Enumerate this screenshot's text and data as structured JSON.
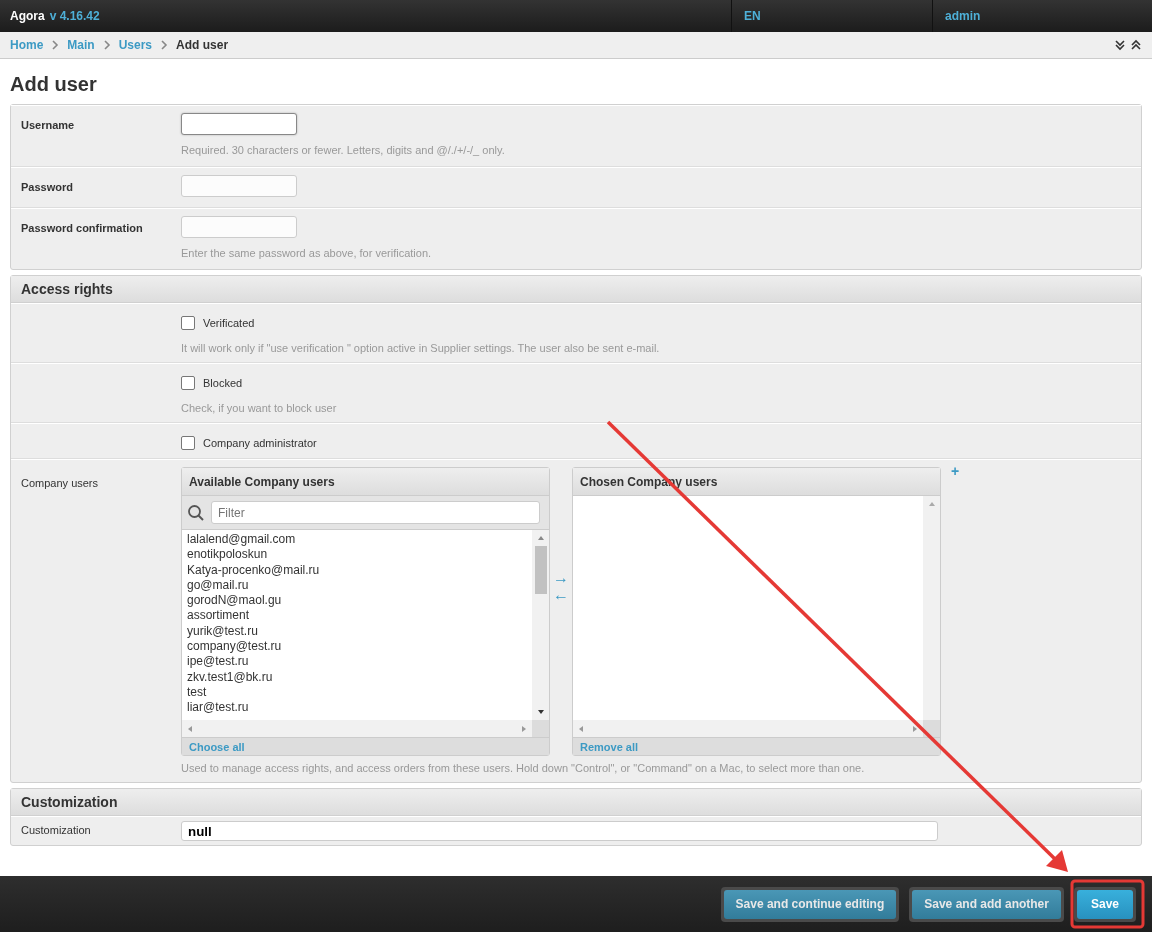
{
  "topbar": {
    "brand": "Agora",
    "version": "v 4.16.42",
    "language": "EN",
    "user": "admin"
  },
  "breadcrumbs": {
    "links": [
      "Home",
      "Main",
      "Users"
    ],
    "current": "Add user"
  },
  "title": "Add user",
  "account_fields": [
    {
      "label": "Username",
      "focused": true,
      "help": "Required. 30 characters or fewer. Letters, digits and @/./+/-/_ only."
    },
    {
      "label": "Password",
      "focused": false
    },
    {
      "label": "Password confirmation",
      "focused": false,
      "help": "Enter the same password as above, for verification."
    }
  ],
  "access_rights": {
    "title": "Access rights",
    "options": [
      {
        "label": "Verificated",
        "checked": false,
        "help": "It will work only if \"use verification \" option active in Supplier settings. The user also be sent e-mail."
      },
      {
        "label": "Blocked",
        "checked": false,
        "help": "Check, if you want to block user"
      },
      {
        "label": "Company administrator",
        "checked": false
      }
    ],
    "company_users": {
      "label": "Company users",
      "available": {
        "title": "Available Company users",
        "filter_placeholder": "Filter",
        "action": "Choose all",
        "items": [
          "lalalend@gmail.com",
          "enotikpoloskun",
          "Katya-procenko@mail.ru",
          "go@mail.ru",
          "gorodN@maol.gu",
          "assortiment",
          "yurik@test.ru",
          "company@test.ru",
          "ipe@test.ru",
          "zkv.test1@bk.ru",
          "test",
          "liar@test.ru"
        ]
      },
      "move_right": "→",
      "move_left": "←",
      "chosen": {
        "title": "Chosen Company users",
        "action": "Remove all"
      },
      "add_symbol": "+",
      "help": "Used to manage access rights, and access orders from these users. Hold down \"Control\", or \"Command\" on a Mac, to select more than one."
    }
  },
  "customization": {
    "title": "Customization",
    "label": "Customization",
    "value": "null"
  },
  "actions": [
    {
      "label": "Save and continue editing",
      "primary": false
    },
    {
      "label": "Save and add another",
      "primary": false
    },
    {
      "label": "Save",
      "primary": true
    }
  ]
}
